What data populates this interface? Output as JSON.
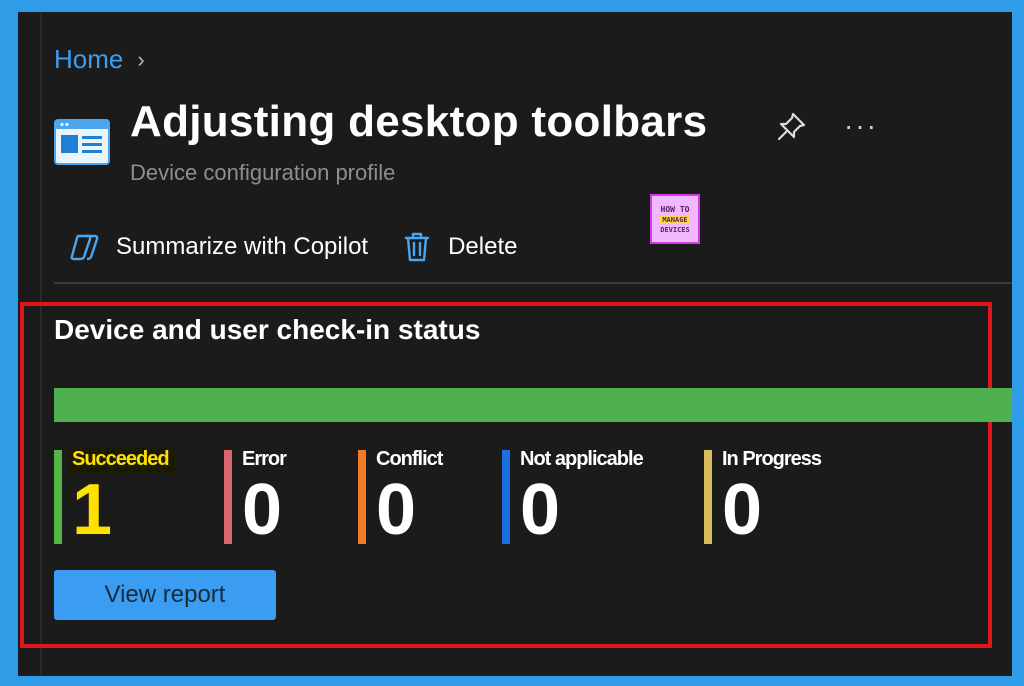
{
  "breadcrumb": {
    "home": "Home",
    "separator": "›"
  },
  "header": {
    "title": "Adjusting desktop toolbars",
    "subtitle": "Device configuration profile",
    "more": "···"
  },
  "logo": {
    "line1": "HOW TO",
    "line2": "MANAGE",
    "line3": "DEVICES"
  },
  "toolbar": {
    "summarize_label": "Summarize with Copilot",
    "delete_label": "Delete"
  },
  "status": {
    "title": "Device and user check-in status",
    "succeeded_fraction": 1.0,
    "items": [
      {
        "label": "Succeeded",
        "value": "1",
        "color": "#57b548"
      },
      {
        "label": "Error",
        "value": "0",
        "color": "#d9666f"
      },
      {
        "label": "Conflict",
        "value": "0",
        "color": "#f07a2a"
      },
      {
        "label": "Not applicable",
        "value": "0",
        "color": "#1e6fe0"
      },
      {
        "label": "In Progress",
        "value": "0",
        "color": "#d8bd5a"
      }
    ],
    "view_report_label": "View report"
  },
  "colors": {
    "accent": "#3a9df2",
    "success": "#4fb04f",
    "highlight_border": "#e0161a",
    "background": "#1b1b1c"
  }
}
